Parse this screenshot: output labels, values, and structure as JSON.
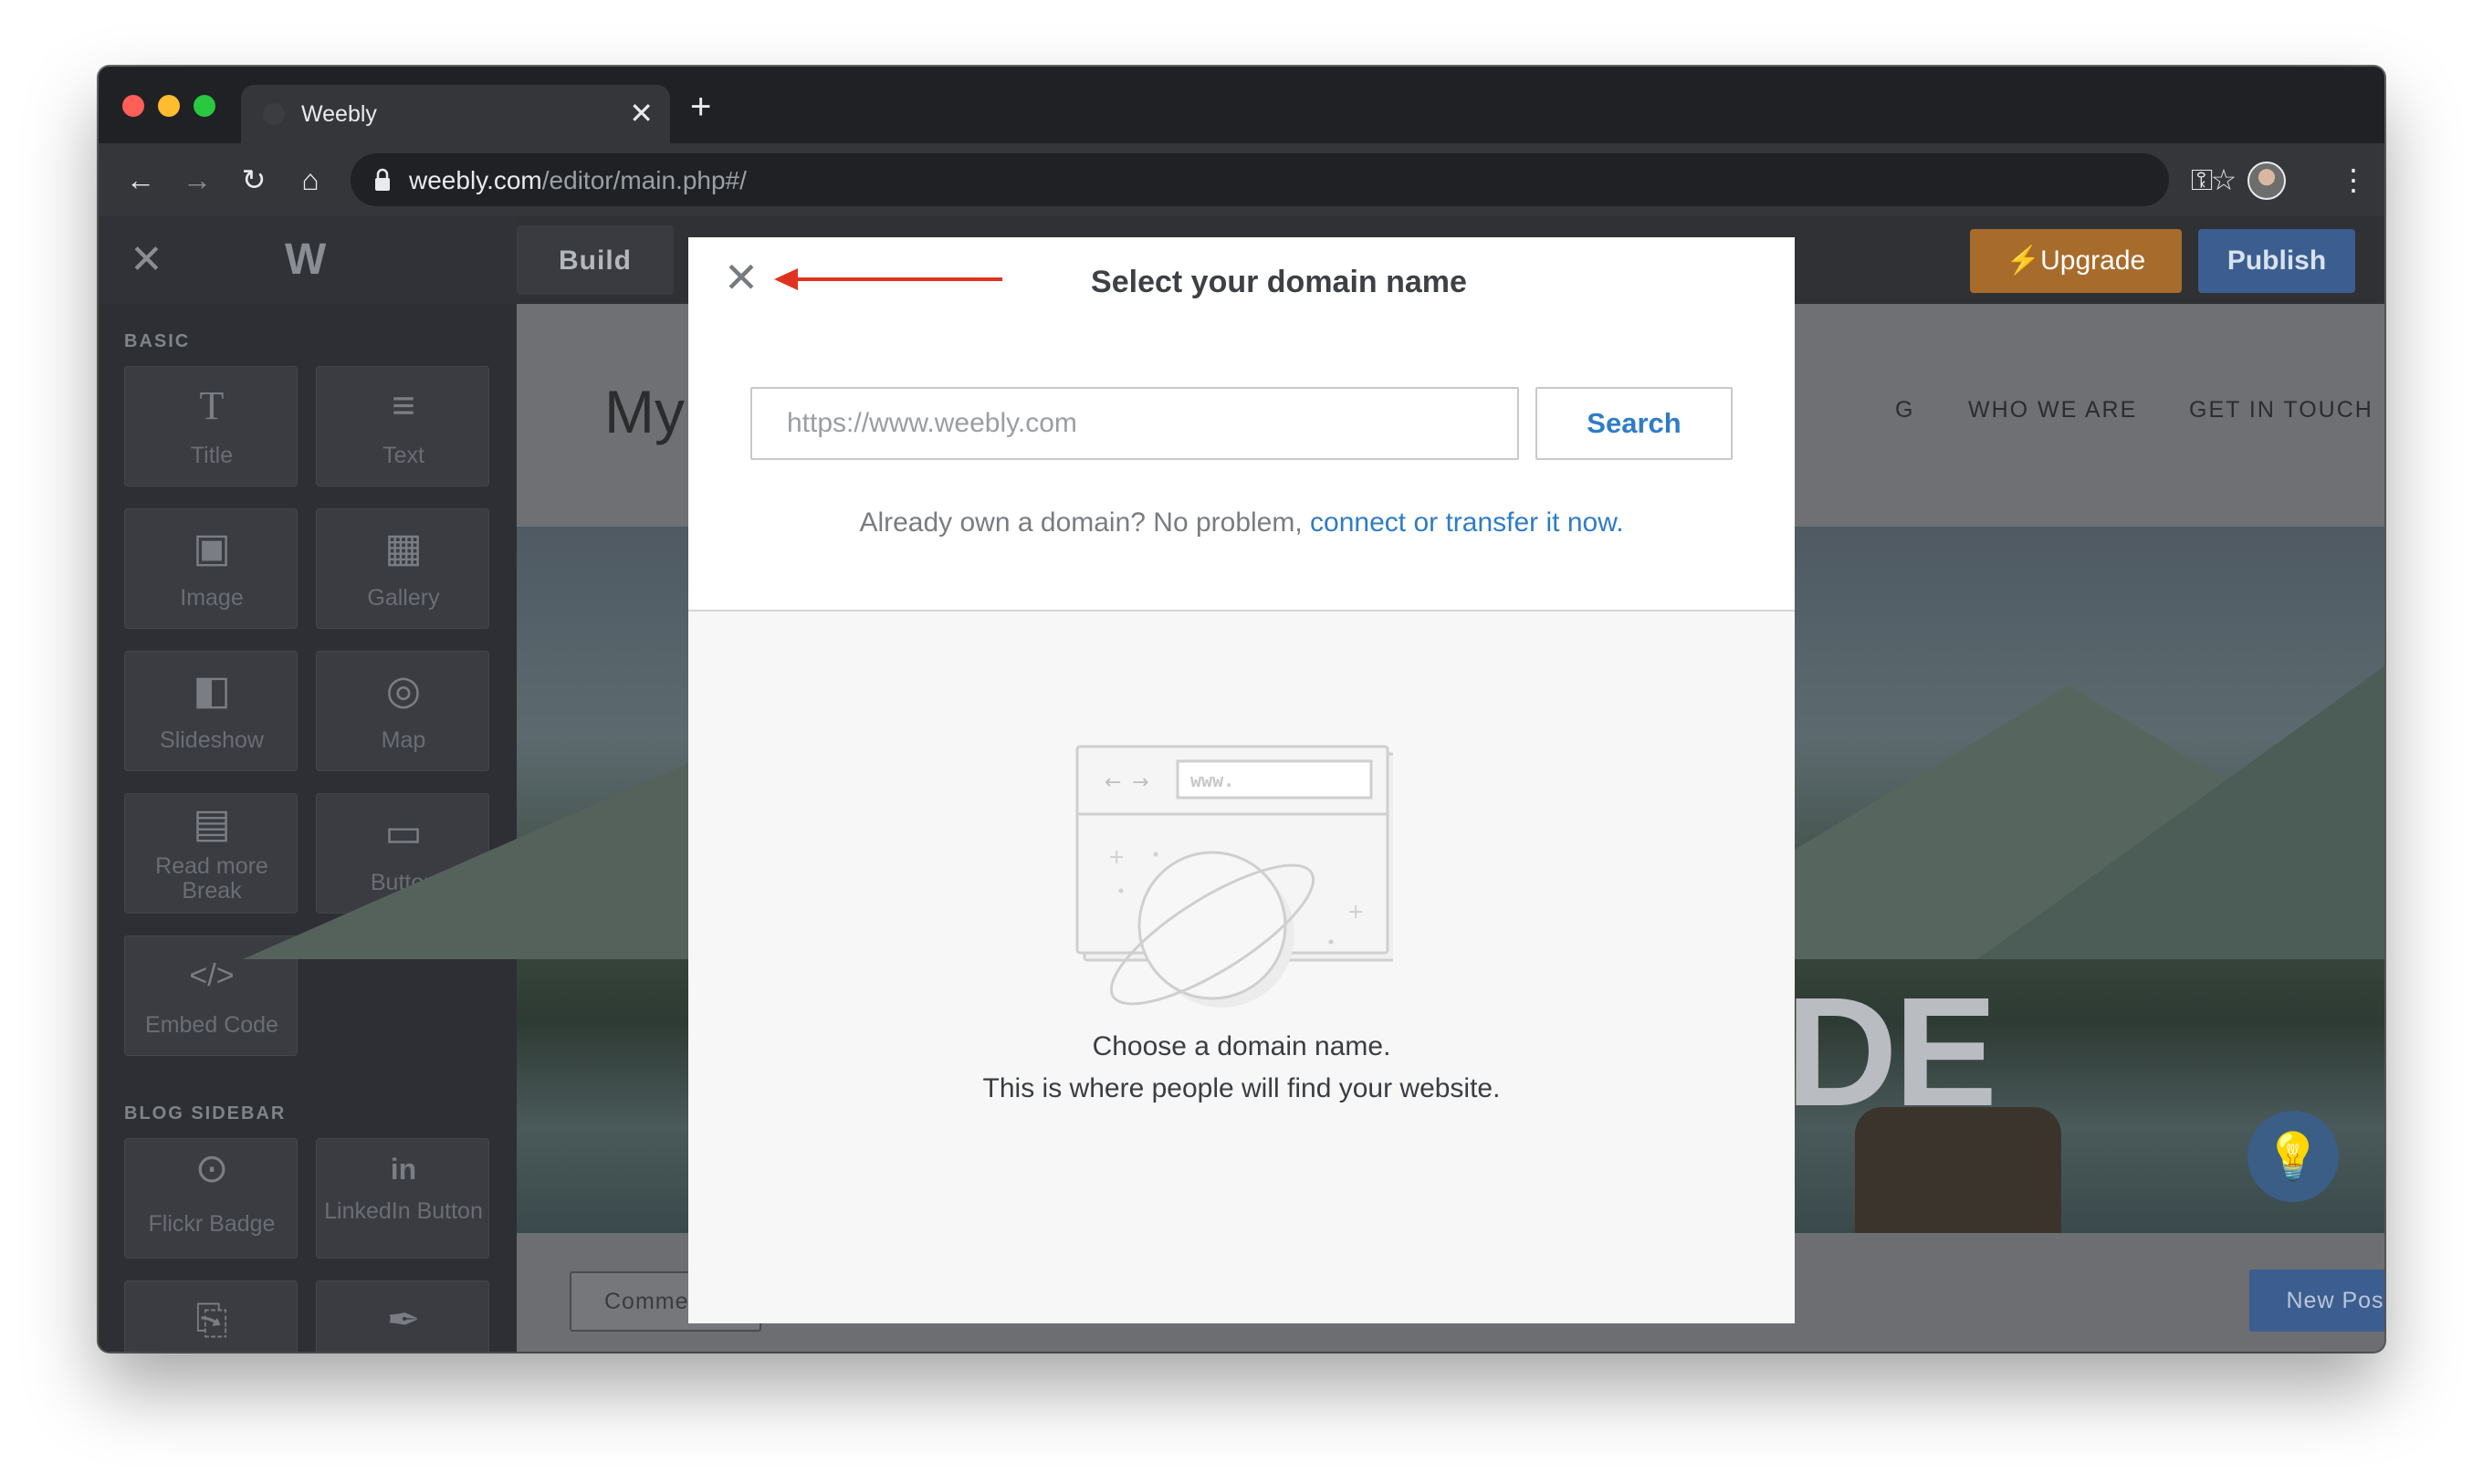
{
  "browser": {
    "tab_title": "Weebly",
    "tab_close": "✕",
    "new_tab": "+",
    "url_host": "weebly.com",
    "url_path": "/editor/main.php#/",
    "back_icon": "←",
    "forward_icon": "→",
    "reload_icon": "↻",
    "home_icon": "⌂",
    "key_icon": "⚿",
    "star_icon": "☆",
    "menu_icon": "⋮"
  },
  "editor": {
    "close_icon": "✕",
    "logo": "W",
    "build_label": "Build",
    "upgrade_label": "Upgrade",
    "publish_label": "Publish",
    "sidebar": {
      "basic_heading": "BASIC",
      "blog_heading": "BLOG SIDEBAR",
      "basic_items": [
        {
          "label": "Title",
          "icon": "T"
        },
        {
          "label": "Text",
          "icon": "≡"
        },
        {
          "label": "Image",
          "icon": "▣"
        },
        {
          "label": "Gallery",
          "icon": "▦"
        },
        {
          "label": "Slideshow",
          "icon": "◧"
        },
        {
          "label": "Map",
          "icon": "◎"
        },
        {
          "label": "Read more Break",
          "icon": "▤"
        },
        {
          "label": "Button",
          "icon": "▭"
        },
        {
          "label": "Embed Code",
          "icon": "</>"
        }
      ],
      "blog_items": [
        {
          "label": "Flickr Badge",
          "icon": "⊙"
        },
        {
          "label": "LinkedIn Button",
          "icon": "in"
        }
      ]
    },
    "site": {
      "title_fragment": "My",
      "nav": [
        "G",
        "WHO WE ARE",
        "GET IN TOUCH"
      ],
      "hero_text_fragment": "DE",
      "comments_label": "Comme",
      "new_post_label": "New Post",
      "lightbulb_icon": "💡"
    }
  },
  "modal": {
    "close_icon": "✕",
    "title": "Select your domain name",
    "input_placeholder": "https://www.weebly.com",
    "search_label": "Search",
    "own_domain_text": "Already own a domain? No problem,",
    "own_domain_link": "connect or transfer it now.",
    "illustration_www": "www.",
    "choose_line1": "Choose a domain name.",
    "choose_line2": "This is where people will find your website."
  },
  "colors": {
    "accent_blue": "#2f7cc6",
    "annotation_arrow": "#e0331f",
    "upgrade_orange": "#a76c2c",
    "publish_blue": "#3c5d8f"
  }
}
